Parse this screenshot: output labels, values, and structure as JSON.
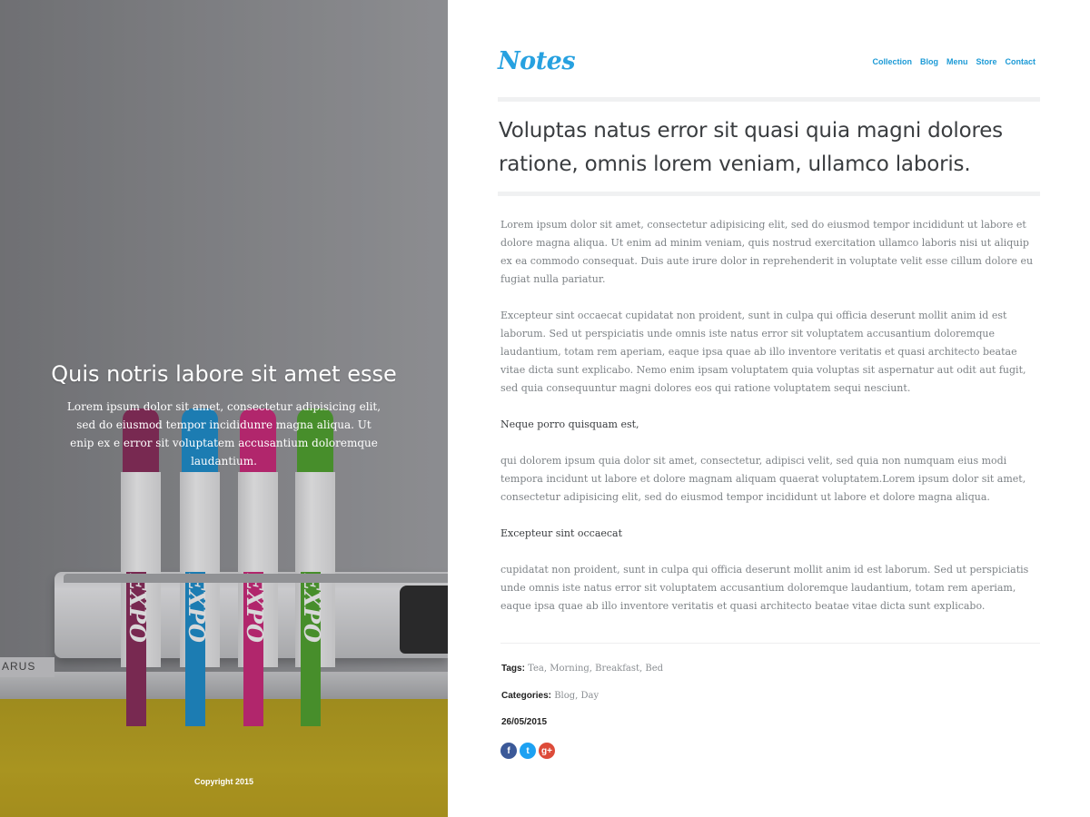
{
  "hero": {
    "title": "Quis notris labore sit amet esse",
    "subtitle": "Lorem ipsum dolor sit amet, consectetur adipisicing elit, sed do eiusmod tempor incididunre magna aliqua. Ut enip ex e error sit voluptatem accusantium doloremque laudantium.",
    "copyright": "Copyright 2015",
    "brand_text": "ARUS",
    "marker_labels": [
      "EXPO",
      "EXPO",
      "EXPO",
      "EXPO"
    ],
    "marker_colors": [
      "#8a2a5a",
      "#1a8fd0",
      "#d0267a",
      "#4fa52b"
    ]
  },
  "site": {
    "logo": "Notes",
    "accent_color": "#27a1e0",
    "nav": [
      "Collection",
      "Blog",
      "Menu",
      "Store",
      "Contact"
    ]
  },
  "post": {
    "headline": "Voluptas natus error sit quasi quia magni dolores ratione, omnis lorem veniam, ullamco laboris.",
    "paragraphs": [
      "Lorem ipsum dolor sit amet, consectetur adipisicing elit, sed do eiusmod tempor incididunt ut labore et dolore magna aliqua. Ut enim ad minim veniam, quis nostrud exercitation ullamco laboris nisi ut aliquip ex ea commodo consequat. Duis aute irure dolor in reprehenderit in voluptate velit esse cillum dolore eu fugiat nulla pariatur.",
      "Excepteur sint occaecat cupidatat non proident, sunt in culpa qui officia deserunt mollit anim id est laborum. Sed ut perspiciatis unde omnis iste natus error sit voluptatem accusantium doloremque laudantium, totam rem aperiam, eaque ipsa quae ab illo inventore veritatis et quasi architecto beatae vitae dicta sunt explicabo. Nemo enim ipsam voluptatem quia voluptas sit aspernatur aut odit aut fugit, sed quia consequuntur magni dolores eos qui ratione voluptatem sequi nesciunt.",
      "Neque porro quisquam est,",
      "qui dolorem ipsum quia dolor sit amet, consectetur, adipisci velit, sed quia non numquam eius modi tempora incidunt ut labore et dolore magnam aliquam quaerat voluptatem.Lorem ipsum dolor sit amet, consectetur adipisicing elit, sed do eiusmod tempor incididunt ut labore et dolore magna aliqua.",
      "Excepteur sint occaecat",
      "cupidatat non proident, sunt in culpa qui officia deserunt mollit anim id est laborum. Sed ut perspiciatis unde omnis iste natus error sit voluptatem accusantium doloremque laudantium, totam rem aperiam, eaque ipsa quae ab illo inventore veritatis et quasi architecto beatae vitae dicta sunt explicabo."
    ],
    "tags_label": "Tags:",
    "tags": [
      "Tea",
      "Morning",
      "Breakfast",
      "Bed"
    ],
    "categories_label": "Categories:",
    "categories": [
      "Blog",
      "Day"
    ],
    "date": "26/05/2015",
    "social": [
      {
        "icon": "facebook-icon",
        "glyph": "f",
        "color": "#3b5998"
      },
      {
        "icon": "twitter-icon",
        "glyph": "t",
        "color": "#1da1f2"
      },
      {
        "icon": "google-plus-icon",
        "glyph": "g+",
        "color": "#dd4b39"
      }
    ]
  }
}
